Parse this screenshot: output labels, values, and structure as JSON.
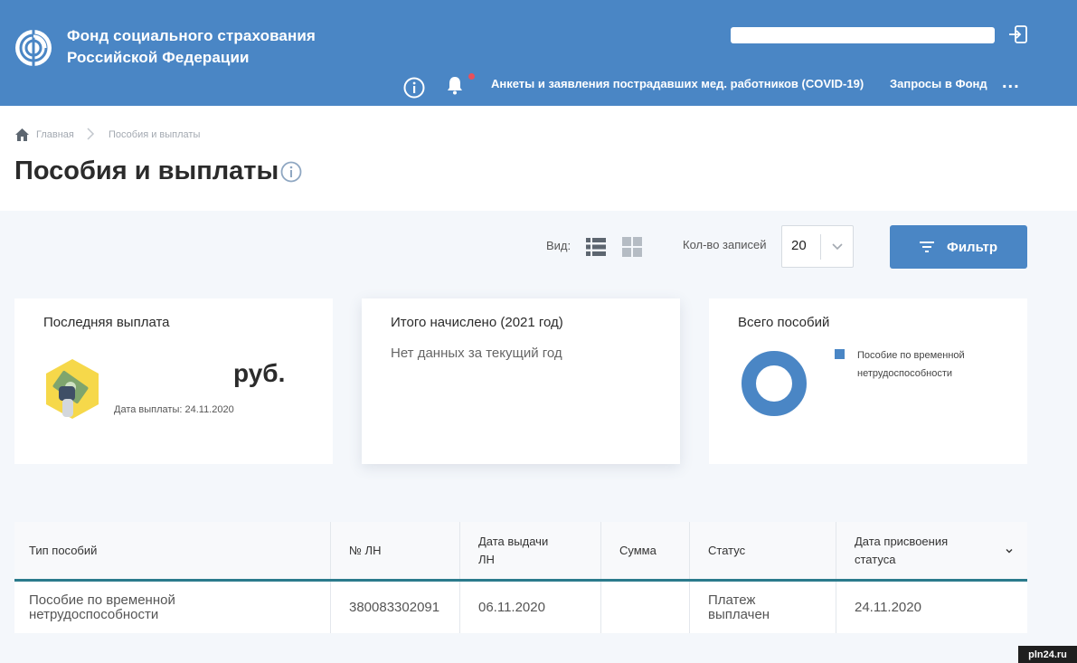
{
  "header": {
    "org_name_line1": "Фонд социального страхования",
    "org_name_line2": "Российской Федерации",
    "nav": {
      "covid_link": "Анкеты и заявления пострадавших мед. работников (COVID-19)",
      "requests_link": "Запросы в Фонд",
      "more": "..."
    },
    "icons": [
      "fss-logo-icon",
      "logout-icon",
      "info-icon",
      "bell-icon"
    ],
    "notification_dot_color": "#e8505b",
    "brand_color": "#4a86c5"
  },
  "breadcrumb": {
    "home": "Главная",
    "current": "Пособия и выплаты"
  },
  "page_title": "Пособия и выплаты",
  "toolbar": {
    "view_label": "Вид:",
    "view_options": [
      "list-view-icon",
      "grid-view-icon"
    ],
    "count_label": "Кол-во записей",
    "count_value": "20",
    "filter_label": "Фильтр"
  },
  "cards": {
    "last_payment": {
      "title": "Последняя выплата",
      "unit": "руб.",
      "date_text": "Дата выплаты: 24.11.2020"
    },
    "total_accrued": {
      "title": "Итого начислено (2021 год)",
      "empty_text": "Нет данных за текущий год"
    },
    "total_benefits": {
      "title": "Всего пособий",
      "legend": "Пособие по временной нетрудоспособности",
      "legend_color": "#4a86c5"
    }
  },
  "table": {
    "headers": [
      "Тип пособий",
      "№ ЛН",
      "Дата выдачи ЛН",
      "Сумма",
      "Статус",
      "Дата присвоения статуса"
    ],
    "header_lines": {
      "date_issue": [
        "Дата выдачи",
        "ЛН"
      ],
      "status_date": [
        "Дата присвоения",
        "статуса"
      ]
    },
    "rows": [
      {
        "type_lines": [
          "Пособие по временной",
          "нетрудоспособности"
        ],
        "ln": "380083302091",
        "issue_date": "06.11.2020",
        "sum": "",
        "status_lines": [
          "Платеж",
          "выплачен"
        ],
        "status_date": "24.11.2020"
      }
    ]
  },
  "watermark": "pln24.ru"
}
